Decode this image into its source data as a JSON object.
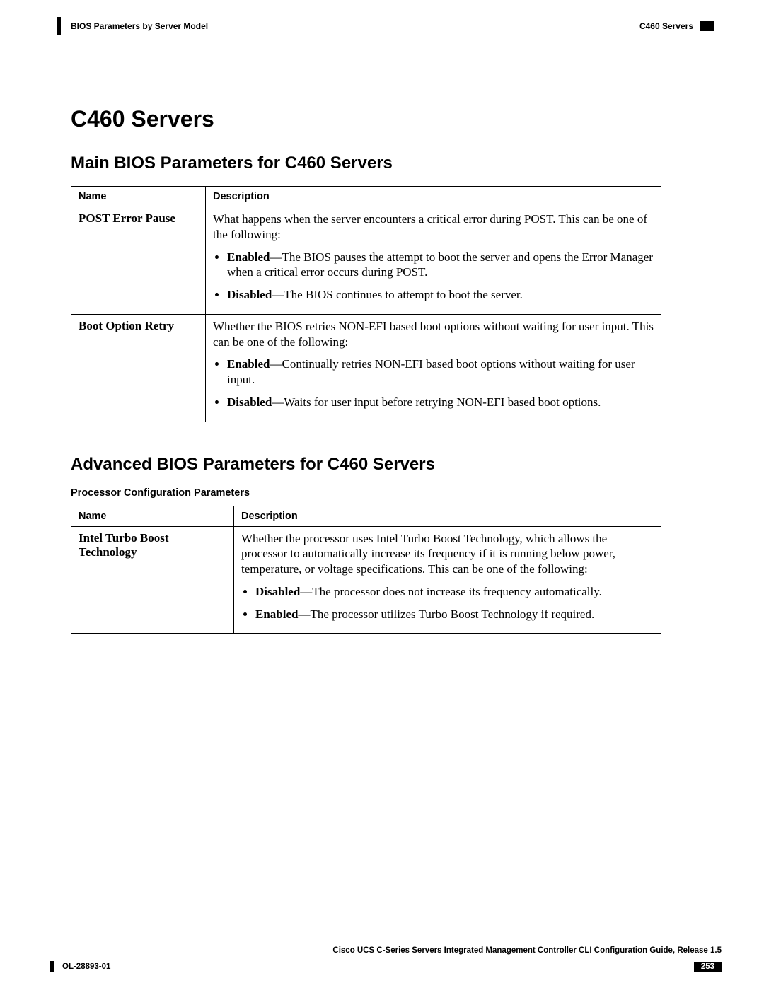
{
  "header": {
    "chapter": "BIOS Parameters by Server Model",
    "section": "C460 Servers"
  },
  "h1": "C460 Servers",
  "section1": {
    "title": "Main BIOS Parameters for C460 Servers",
    "col_name": "Name",
    "col_desc": "Description",
    "rows": [
      {
        "name": "POST Error Pause",
        "intro": "What happens when the server encounters a critical error during POST. This can be one of the following:",
        "opts": [
          {
            "label": "Enabled",
            "text": "—The BIOS pauses the attempt to boot the server and opens the Error Manager when a critical error occurs during POST."
          },
          {
            "label": "Disabled",
            "text": "—The BIOS continues to attempt to boot the server."
          }
        ]
      },
      {
        "name": "Boot Option Retry",
        "intro": "Whether the BIOS retries NON-EFI based boot options without waiting for user input. This can be one of the following:",
        "opts": [
          {
            "label": "Enabled",
            "text": "—Continually retries NON-EFI based boot options without waiting for user input."
          },
          {
            "label": "Disabled",
            "text": "—Waits for user input before retrying NON-EFI based boot options."
          }
        ]
      }
    ]
  },
  "section2": {
    "title": "Advanced BIOS Parameters for C460 Servers",
    "subtitle": "Processor Configuration Parameters",
    "col_name": "Name",
    "col_desc": "Description",
    "rows": [
      {
        "name": "Intel Turbo Boost Technology",
        "intro": "Whether the processor uses Intel Turbo Boost Technology, which allows the processor to automatically increase its frequency if it is running below power, temperature, or voltage specifications. This can be one of the following:",
        "opts": [
          {
            "label": "Disabled",
            "text": "—The processor does not increase its frequency automatically."
          },
          {
            "label": "Enabled",
            "text": "—The processor utilizes Turbo Boost Technology if required."
          }
        ]
      }
    ]
  },
  "footer": {
    "title": "Cisco UCS C-Series Servers Integrated Management Controller CLI Configuration Guide, Release 1.5",
    "doc_id": "OL-28893-01",
    "page": "253"
  }
}
